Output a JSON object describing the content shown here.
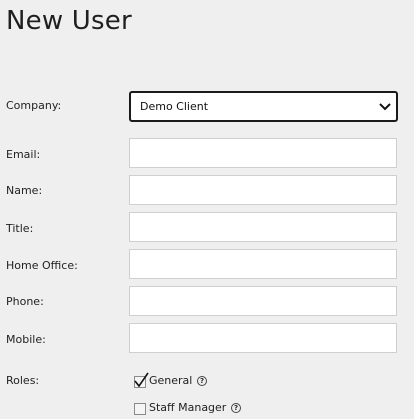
{
  "page": {
    "title": "New User"
  },
  "form": {
    "company": {
      "label": "Company:",
      "selected": "Demo Client"
    },
    "email": {
      "label": "Email:",
      "value": ""
    },
    "name": {
      "label": "Name:",
      "value": ""
    },
    "title": {
      "label": "Title:",
      "value": ""
    },
    "home_office": {
      "label": "Home Office:",
      "value": ""
    },
    "phone": {
      "label": "Phone:",
      "value": ""
    },
    "mobile": {
      "label": "Mobile:",
      "value": ""
    },
    "roles": {
      "label": "Roles:",
      "options": [
        {
          "label": "General",
          "checked": true,
          "help_icon": "question-circle-icon",
          "help_glyph": "?"
        },
        {
          "label": "Staff Manager",
          "checked": false,
          "help_icon": "question-circle-icon",
          "help_glyph": "?"
        }
      ]
    }
  }
}
